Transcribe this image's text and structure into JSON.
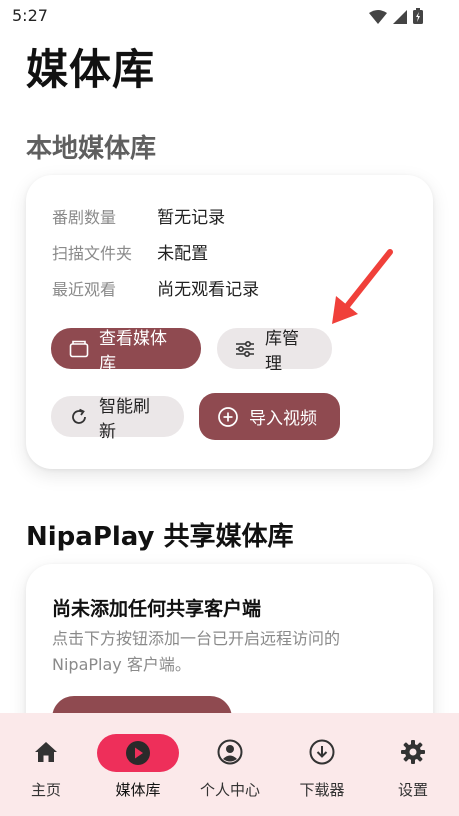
{
  "status_bar": {
    "time": "5:27"
  },
  "page": {
    "title": "媒体库"
  },
  "local_library": {
    "section_title": "本地媒体库",
    "rows": [
      {
        "label": "番剧数量",
        "value": "暂无记录"
      },
      {
        "label": "扫描文件夹",
        "value": "未配置"
      },
      {
        "label": "最近观看",
        "value": "尚无观看记录"
      }
    ],
    "buttons": {
      "view_library": "查看媒体库",
      "manage_library": "库管理",
      "smart_refresh": "智能刷新",
      "import_video": "导入视频"
    }
  },
  "shared_library": {
    "section_title": "NipaPlay 共享媒体库",
    "heading": "尚未添加任何共享客户端",
    "description": "点击下方按钮添加一台已开启远程访问的 NipaPlay 客户端。"
  },
  "bottom_nav": [
    {
      "label": "主页",
      "icon": "home-icon"
    },
    {
      "label": "媒体库",
      "icon": "play-icon",
      "active": true
    },
    {
      "label": "个人中心",
      "icon": "user-icon"
    },
    {
      "label": "下载器",
      "icon": "download-icon"
    },
    {
      "label": "设置",
      "icon": "gear-icon"
    }
  ],
  "colors": {
    "accent": "#8f4a50",
    "active_pill": "#ee2f5a",
    "nav_bg": "#fbe9ea",
    "annotation_arrow": "#f0403a"
  }
}
